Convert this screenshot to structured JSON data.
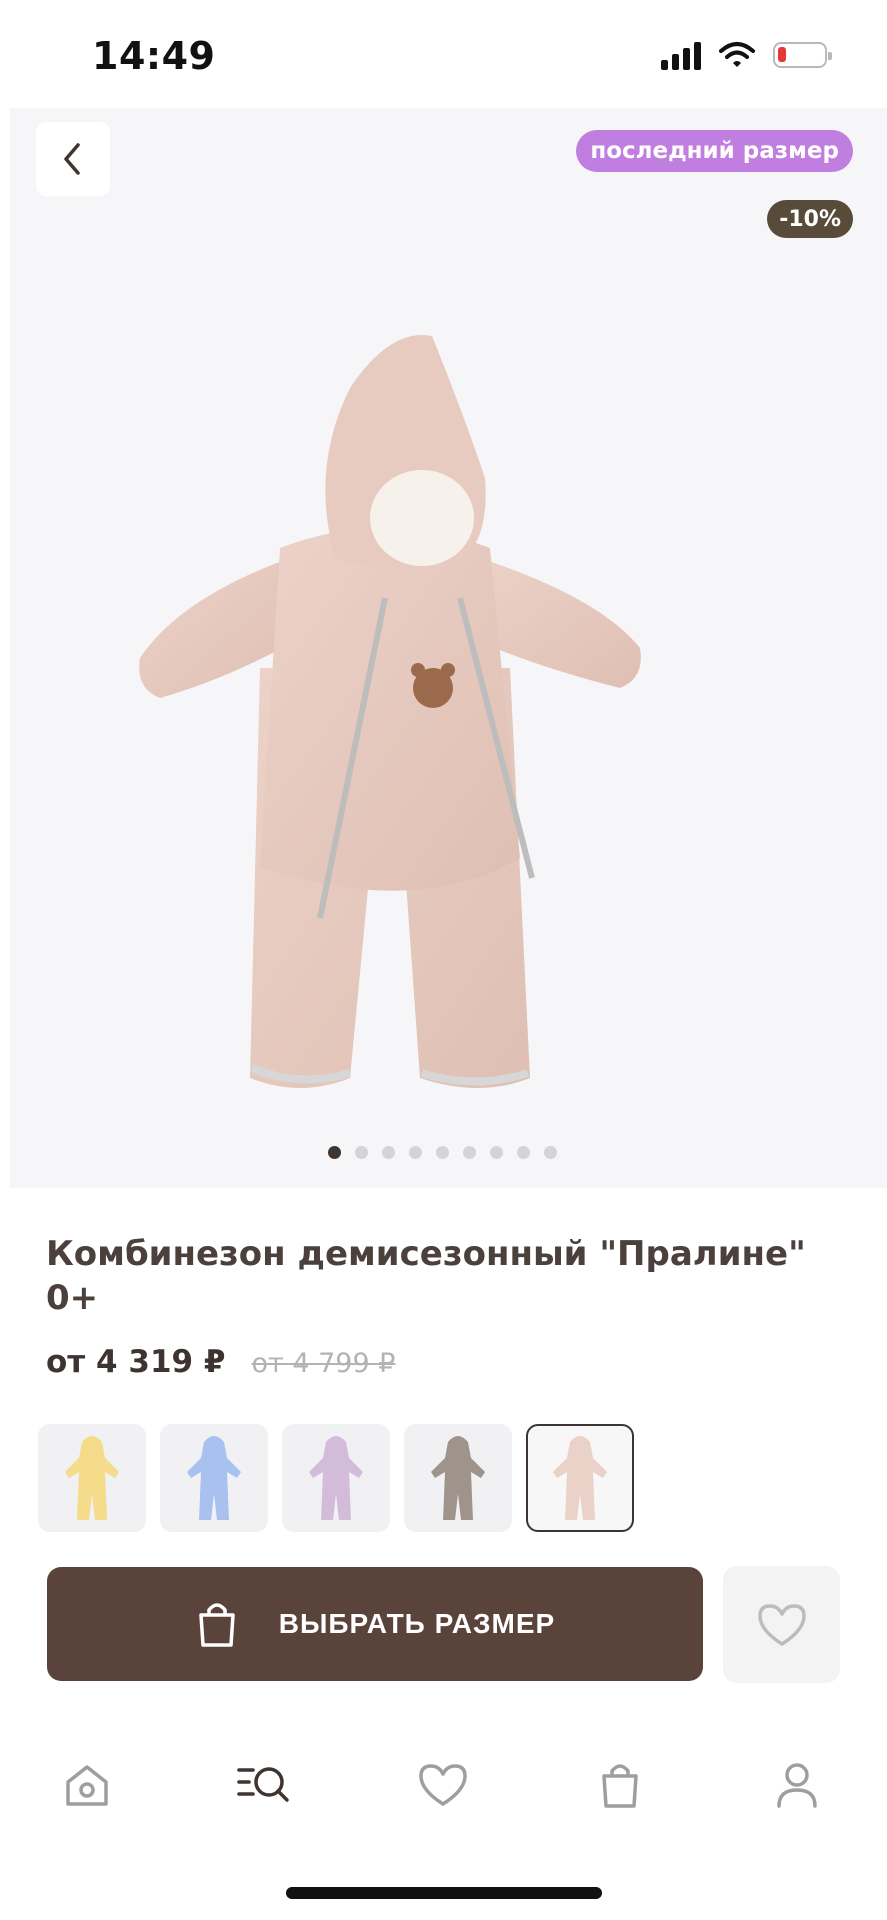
{
  "status_bar": {
    "time": "14:49"
  },
  "product": {
    "badge_label": "последний размер",
    "discount": "-10%",
    "title": "Комбинезон демисезонный \"Пралине\" 0+",
    "price": "от 4 319 ₽",
    "old_price": "от 4 799 ₽",
    "image_count": 9,
    "active_image": 1
  },
  "color_options": [
    {
      "name": "yellow",
      "color": "#f4dc8a"
    },
    {
      "name": "blue",
      "color": "#a9c1ef"
    },
    {
      "name": "lilac",
      "color": "#d3bcd9"
    },
    {
      "name": "grey",
      "color": "#9e948c"
    },
    {
      "name": "pink",
      "color": "#ead2c8",
      "selected": true
    }
  ],
  "actions": {
    "select_size_label": "ВЫБРАТЬ РАЗМЕР"
  },
  "nav": [
    "home-icon",
    "catalog-search-icon",
    "favorites-icon",
    "cart-icon",
    "profile-icon"
  ],
  "colors": {
    "accent_brown": "#5a433b",
    "badge_purple": "#c07ee0",
    "badge_discount": "#584b3a"
  }
}
